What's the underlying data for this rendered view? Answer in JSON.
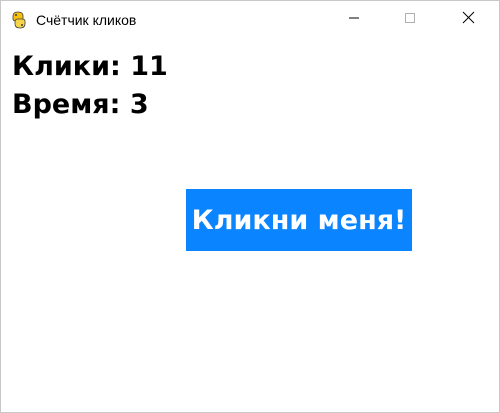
{
  "window": {
    "title": "Счётчик кликов",
    "app_icon": "python-snake-icon",
    "controls": {
      "minimize": "minimize-icon",
      "maximize": "maximize-icon",
      "close": "close-icon"
    }
  },
  "stats": {
    "clicks_label": "Клики: 11",
    "time_label": "Время: 3"
  },
  "button": {
    "label": "Кликни меня!",
    "color": "#0a84ff",
    "text_color": "#ffffff"
  }
}
